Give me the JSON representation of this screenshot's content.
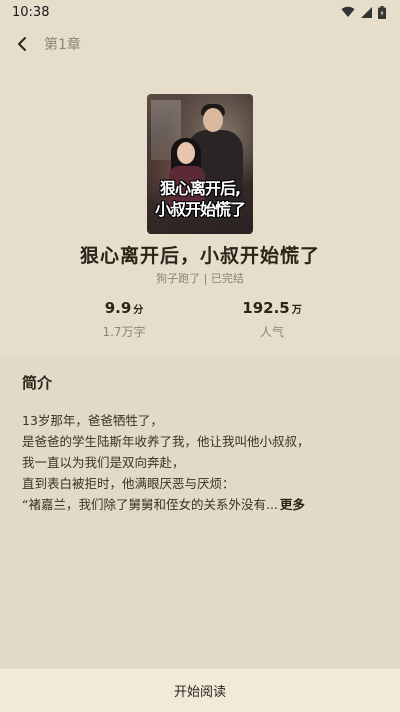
{
  "status_bar": {
    "time": "10:38",
    "icons": [
      "wifi-icon",
      "cell-signal-icon",
      "battery-icon"
    ]
  },
  "header": {
    "chapter": "第1章"
  },
  "book": {
    "cover_text_line1": "狠心离开后,",
    "cover_text_line2": "小叔开始慌了",
    "title": "狠心离开后，小叔开始慌了",
    "meta": "狗子跑了 | 已完结"
  },
  "stats": {
    "score": {
      "value": "9.9",
      "unit": "分",
      "label": "1.7万字"
    },
    "popularity": {
      "value": "192.5",
      "unit": "万",
      "label": "人气"
    }
  },
  "intro": {
    "heading": "简介",
    "lines": [
      "13岁那年，爸爸牺牲了，",
      "是爸爸的学生陆斯年收养了我，他让我叫他小叔叔，",
      "我一直以为我们是双向奔赴，",
      "直到表白被拒时，他满眼厌恶与厌烦：",
      "“褚嘉兰，我们除了舅舅和侄女的关系外没有..."
    ],
    "more": "更多"
  },
  "bottom": {
    "start_reading": "开始阅读"
  },
  "colors": {
    "background": "#e6ddcb",
    "panel": "#e2d9c8",
    "bottom_bar": "#f1e9d9"
  }
}
